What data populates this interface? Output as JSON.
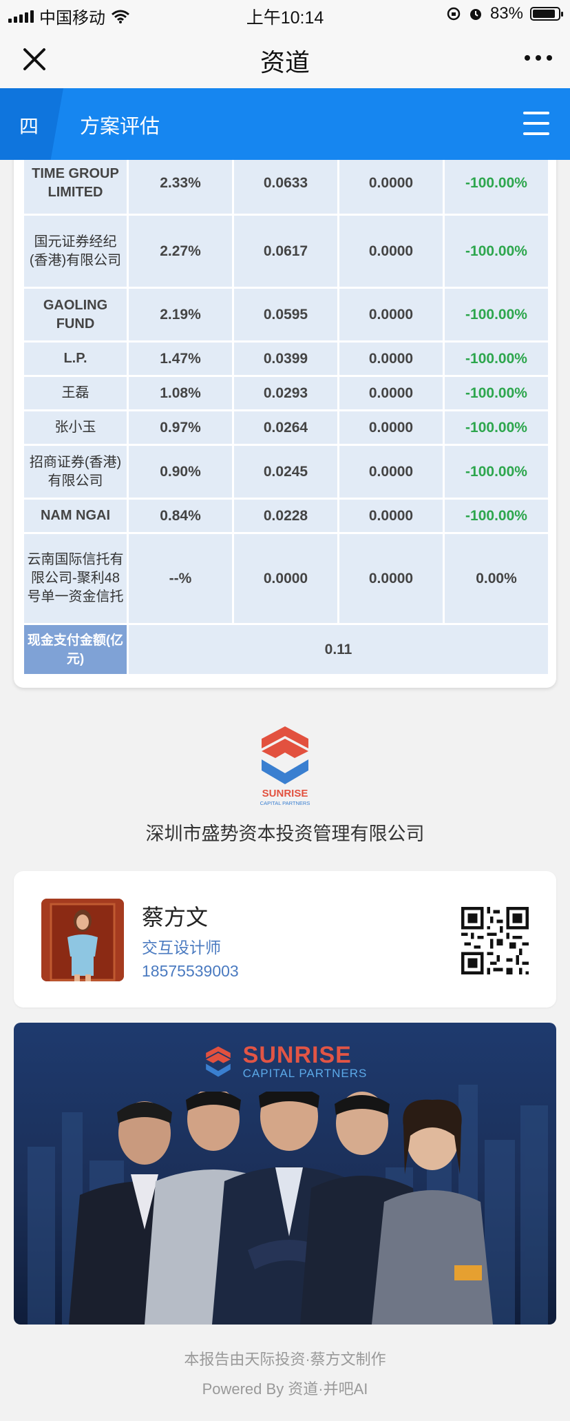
{
  "status_bar": {
    "carrier": "中国移动",
    "time": "上午10:14",
    "battery": "83%"
  },
  "nav": {
    "title": "资道"
  },
  "section": {
    "number": "四",
    "title": "方案评估"
  },
  "table": {
    "rows": [
      {
        "name": "TIME GROUP LIMITED",
        "c1": "2.33%",
        "c2": "0.0633",
        "c3": "0.0000",
        "c4": "-100.00%",
        "negative": true
      },
      {
        "name": "国元证券经纪(香港)有限公司",
        "c1": "2.27%",
        "c2": "0.0617",
        "c3": "0.0000",
        "c4": "-100.00%",
        "negative": true
      },
      {
        "name": "GAOLING FUND",
        "c1": "2.19%",
        "c2": "0.0595",
        "c3": "0.0000",
        "c4": "-100.00%",
        "negative": true
      },
      {
        "name": "L.P.",
        "c1": "1.47%",
        "c2": "0.0399",
        "c3": "0.0000",
        "c4": "-100.00%",
        "negative": true
      },
      {
        "name": "王磊",
        "c1": "1.08%",
        "c2": "0.0293",
        "c3": "0.0000",
        "c4": "-100.00%",
        "negative": true
      },
      {
        "name": "张小玉",
        "c1": "0.97%",
        "c2": "0.0264",
        "c3": "0.0000",
        "c4": "-100.00%",
        "negative": true
      },
      {
        "name": "招商证券(香港)有限公司",
        "c1": "0.90%",
        "c2": "0.0245",
        "c3": "0.0000",
        "c4": "-100.00%",
        "negative": true
      },
      {
        "name": "NAM NGAI",
        "c1": "0.84%",
        "c2": "0.0228",
        "c3": "0.0000",
        "c4": "-100.00%",
        "negative": true
      },
      {
        "name": "云南国际信托有限公司-聚利48号单一资金信托",
        "c1": "--%",
        "c2": "0.0000",
        "c3": "0.0000",
        "c4": "0.00%",
        "negative": false
      }
    ],
    "cash_label": "现金支付金额(亿元)",
    "cash_value": "0.11"
  },
  "company": {
    "logo_text": "SUNRISE",
    "logo_sub": "CAPITAL PARTNERS",
    "name": "深圳市盛势资本投资管理有限公司"
  },
  "contact": {
    "name": "蔡方文",
    "role": "交互设计师",
    "phone": "18575539003"
  },
  "banner": {
    "brand": "SUNRISE",
    "brand_sub": "CAPITAL PARTNERS"
  },
  "footer": {
    "line1": "本报告由天际投资·蔡方文制作",
    "line2": "Powered By 资道·并吧AI"
  },
  "colors": {
    "accent": "#1686f0",
    "negative": "#2da64d",
    "cell": "#e2ebf6",
    "cash_label": "#7fa2d6"
  }
}
